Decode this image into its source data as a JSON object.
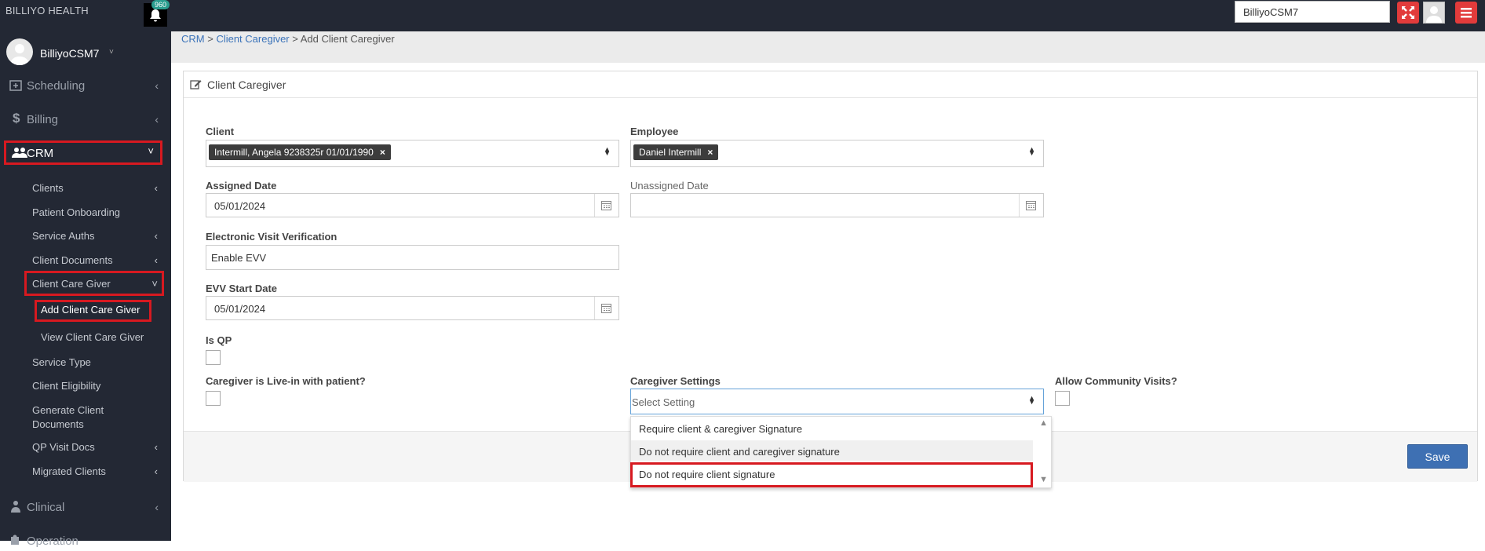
{
  "app": {
    "brand": "BILLIYO HEALTH",
    "notification_count": "960",
    "user_search_value": "BilliyoCSM7"
  },
  "sidebar": {
    "username": "BilliyoCSM7",
    "sections": {
      "scheduling": "Scheduling",
      "billing": "Billing",
      "crm": "CRM",
      "clinical": "Clinical",
      "operation": "Operation"
    },
    "crm_items": {
      "clients": "Clients",
      "patient_onboarding": "Patient Onboarding",
      "service_auths": "Service Auths",
      "client_documents": "Client Documents",
      "client_care_giver": "Client Care Giver",
      "add_client_care_giver": "Add Client Care Giver",
      "view_client_care_giver": "View Client Care Giver",
      "service_type": "Service Type",
      "client_eligibility": "Client Eligibility",
      "generate_client_documents_1": "Generate Client",
      "generate_client_documents_2": "Documents",
      "qp_visit_docs": "QP Visit Docs",
      "migrated_clients": "Migrated Clients"
    }
  },
  "breadcrumb": {
    "crm": "CRM",
    "sep1": " > ",
    "client_caregiver": "Client Caregiver",
    "sep2": " > ",
    "current": "Add Client Caregiver"
  },
  "panel": {
    "title": "Client Caregiver"
  },
  "form": {
    "client_label": "Client",
    "client_tag": "Intermill, Angela 9238325r 01/01/1990",
    "employee_label": "Employee",
    "employee_tag": "Daniel Intermill",
    "assigned_date_label": "Assigned Date",
    "assigned_date_value": "05/01/2024",
    "unassigned_date_label": "Unassigned Date",
    "unassigned_date_value": "",
    "evv_label": "Electronic Visit Verification",
    "evv_value": "Enable EVV",
    "evv_start_label": "EVV Start Date",
    "evv_start_value": "05/01/2024",
    "is_qp_label": "Is QP",
    "live_in_label": "Caregiver is Live-in with patient?",
    "caregiver_settings_label": "Caregiver Settings",
    "caregiver_settings_placeholder": "Select Setting",
    "community_visits_label": "Allow Community Visits?"
  },
  "dropdown": {
    "options": [
      "Require client & caregiver Signature",
      "Do not require client and caregiver signature",
      "Do not require client signature"
    ]
  },
  "footer": {
    "save_label": "Save"
  },
  "colors": {
    "highlight": "#d71920",
    "sidebar_bg": "#232834",
    "primary_button": "#3e70b3"
  }
}
